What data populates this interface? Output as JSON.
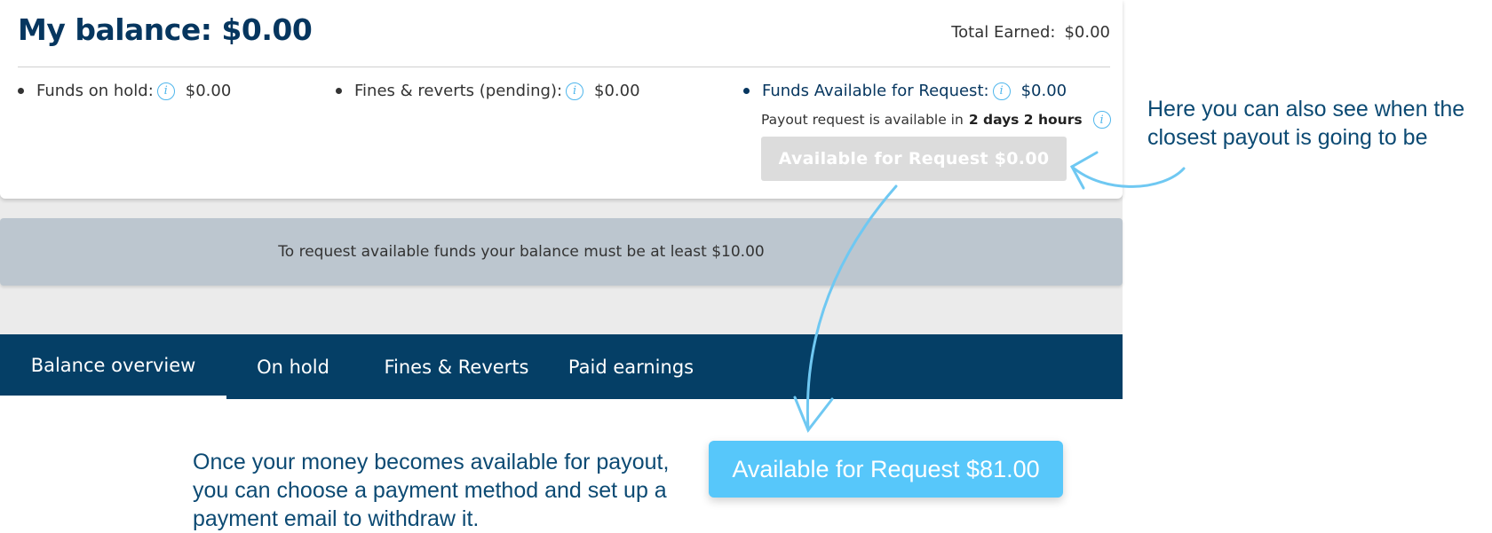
{
  "balance": {
    "title": "My balance: $0.00",
    "total_label": "Total Earned:",
    "total_value": "$0.00"
  },
  "stats": [
    {
      "label": "Funds on hold:",
      "value": "$0.00",
      "icon": "info-icon"
    },
    {
      "label": "Fines & reverts (pending):",
      "value": "$0.00",
      "icon": "info-icon"
    },
    {
      "label": "Funds Available for Request:",
      "value": "$0.00",
      "icon": "info-icon"
    }
  ],
  "payout_note": {
    "prefix": "Payout request is available in",
    "time": "2 days 2 hours"
  },
  "request_button_disabled": "Available for Request $0.00",
  "notice": "To request available funds your balance must be at least $10.00",
  "tabs": [
    {
      "label": "Balance overview",
      "active": true
    },
    {
      "label": "On hold",
      "active": false
    },
    {
      "label": "Fines & Reverts",
      "active": false
    },
    {
      "label": "Paid earnings",
      "active": false
    }
  ],
  "annotations": {
    "right": "Here you can also see when the closest payout is going to be",
    "bottom": "Once your money becomes available for payout, you can choose a payment method and set up a payment email to withdraw it."
  },
  "request_button_active": "Available for Request $81.00",
  "colors": {
    "brand_navy": "#053f66",
    "accent_blue": "#57c7fa",
    "info_blue": "#4fb6ec",
    "notice_bg": "#bcc6cf",
    "disabled_button": "#dcdcdc"
  }
}
